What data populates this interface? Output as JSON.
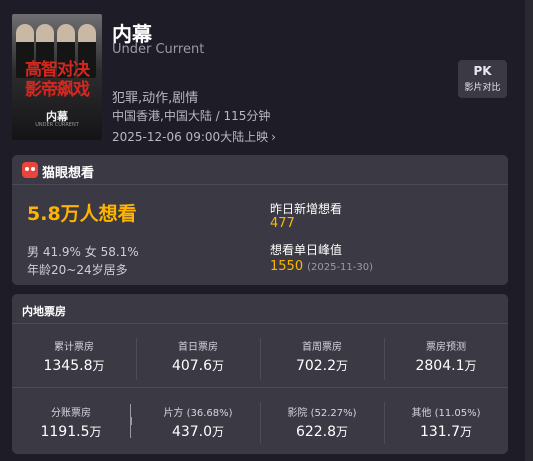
{
  "movie": {
    "title": "内幕",
    "english_title": "Under Current",
    "genres": "犯罪,动作,剧情",
    "region_duration": "中国香港,中国大陆 / 115分钟",
    "release": "2025-12-06 09:00大陆上映",
    "poster": {
      "tagline_line1": "高智对决",
      "tagline_line2": "影帝飙戏",
      "title": "内幕",
      "subtitle": "UNDER CURRENT"
    }
  },
  "pk_button": {
    "line1": "PK",
    "line2": "影片对比"
  },
  "want": {
    "header": "猫眼想看",
    "total": "5.8万人想看",
    "gender": "男 41.9%  女 58.1%",
    "age": "年龄20~24岁居多",
    "new_label": "昨日新增想看",
    "new_value": "477",
    "peak_label": "想看单日峰值",
    "peak_value": "1550",
    "peak_date": "(2025-11-30)"
  },
  "box_office": {
    "header": "内地票房",
    "row1": [
      {
        "label": "累计票房",
        "value": "1345.8",
        "unit": "万"
      },
      {
        "label": "首日票房",
        "value": "407.6",
        "unit": "万"
      },
      {
        "label": "首周票房",
        "value": "702.2",
        "unit": "万"
      },
      {
        "label": "票房预测",
        "value": "2804.1",
        "unit": "万"
      }
    ],
    "row2": [
      {
        "label": "分账票房",
        "value": "1191.5",
        "unit": "万"
      },
      {
        "label": "片方 (36.68%)",
        "value": "437.0",
        "unit": "万"
      },
      {
        "label": "影院 (52.27%)",
        "value": "622.8",
        "unit": "万"
      },
      {
        "label": "其他 (11.05%)",
        "value": "131.7",
        "unit": "万"
      }
    ]
  },
  "colors": {
    "background": "#1e1d27",
    "card": "#3a3944",
    "accent": "#ffb400",
    "logo": "#e8453c"
  }
}
